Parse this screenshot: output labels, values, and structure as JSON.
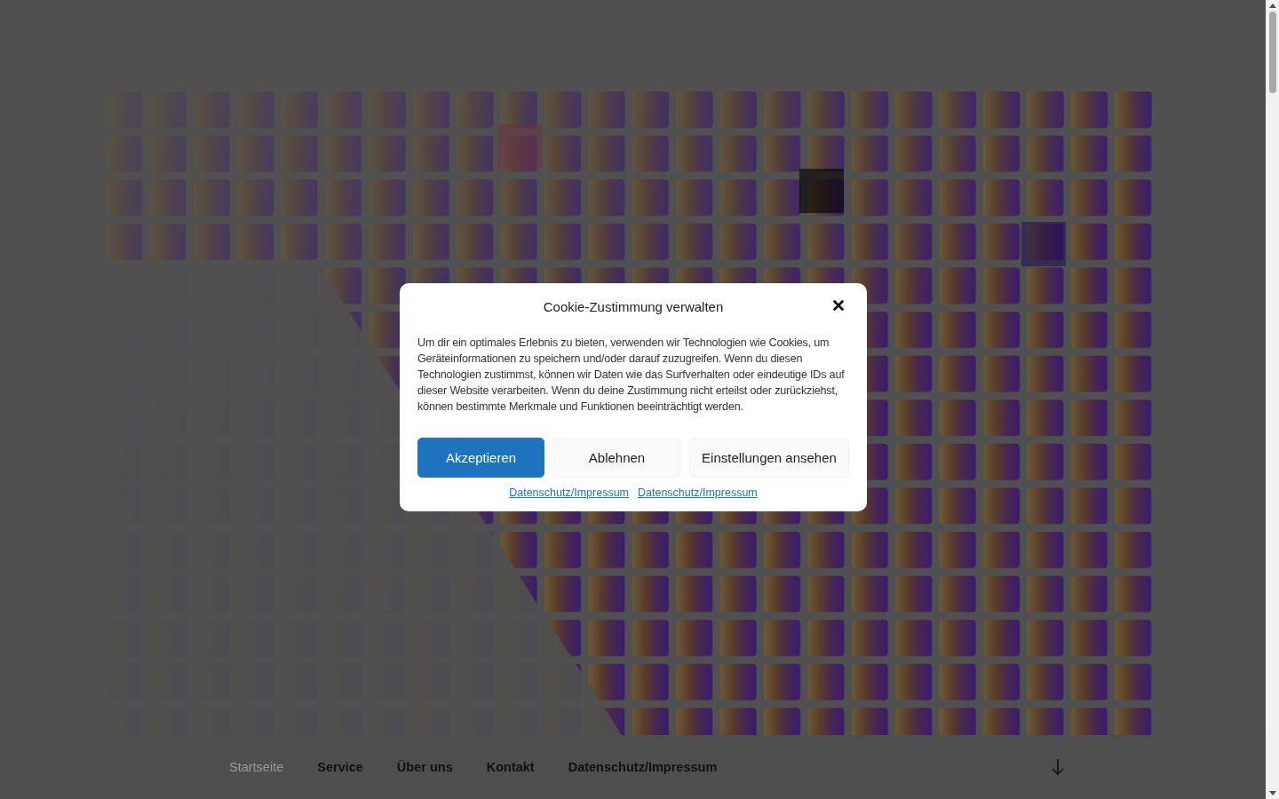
{
  "navigation": {
    "items": [
      {
        "label": "Startseite",
        "selected": true
      },
      {
        "label": "Service",
        "selected": false
      },
      {
        "label": "Über uns",
        "selected": false
      },
      {
        "label": "Kontakt",
        "selected": false
      },
      {
        "label": "Datenschutz/Impressum",
        "selected": false
      }
    ]
  },
  "cookie_dialog": {
    "title": "Cookie-Zustimmung verwalten",
    "text": "Um dir ein optimales Erlebnis zu bieten, verwenden wir Technologien wie Cookies, um Geräteinformationen zu speichern und/oder darauf zuzugreifen. Wenn du diesen Technologien zustimmst, können wir Daten wie das Surfverhalten oder eindeutige IDs auf dieser Website verarbeiten. Wenn du deine Zustimmung nicht erteilst oder zurückziehst, können bestimmte Merkmale und Funktionen beeinträchtigt werden.",
    "buttons": [
      {
        "label": "Akzeptieren",
        "kind": "primary"
      },
      {
        "label": "Ablehnen",
        "kind": "secondary"
      },
      {
        "label": "Einstellungen ansehen",
        "kind": "secondary"
      }
    ],
    "links": [
      "Datenschutz/Impressum",
      "Datenschutz/Impressum"
    ]
  }
}
